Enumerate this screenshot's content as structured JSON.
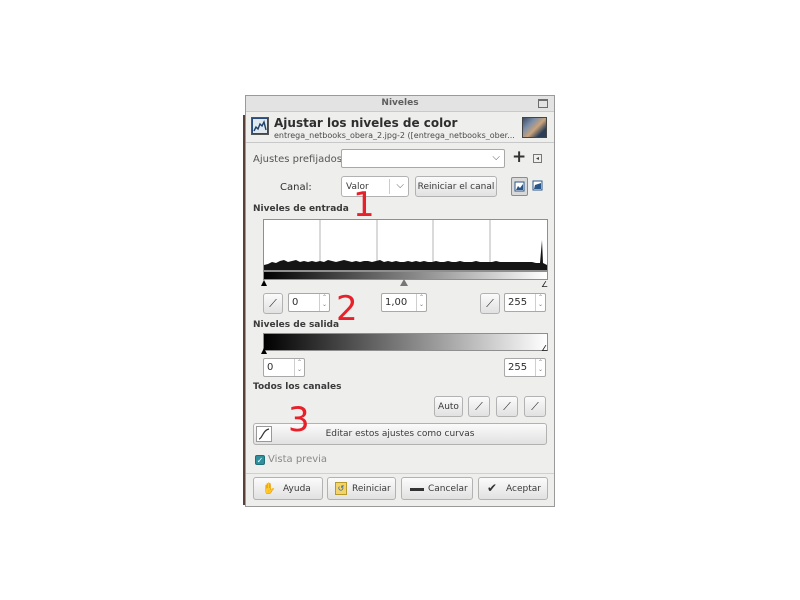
{
  "window": {
    "title": "Niveles"
  },
  "header": {
    "title": "Ajustar los niveles de color",
    "subtitle": "entrega_netbooks_obera_2.jpg-2 ([entrega_netbooks_ober..."
  },
  "presets": {
    "label": "Ajustes prefijados:",
    "value": ""
  },
  "channel": {
    "label": "Canal:",
    "value": "Valor",
    "reset_label": "Reiniciar el canal"
  },
  "input_levels": {
    "title": "Niveles de entrada",
    "low": "0",
    "gamma": "1,00",
    "high": "255"
  },
  "output_levels": {
    "title": "Niveles de salida",
    "low": "0",
    "high": "255"
  },
  "all_channels": {
    "title": "Todos los canales",
    "auto_label": "Auto"
  },
  "curves_button": {
    "label": "Editar estos ajustes como curvas"
  },
  "preview": {
    "label": "Vista previa",
    "checked": true
  },
  "buttons": {
    "help": "Ayuda",
    "reset": "Reiniciar",
    "cancel": "Cancelar",
    "ok": "Aceptar"
  },
  "annotations": [
    "1",
    "2",
    "3"
  ],
  "icons": [
    "levels-icon",
    "image-thumbnail-icon",
    "add-icon",
    "menu-arrow-icon",
    "linear-histogram-icon",
    "log-histogram-icon",
    "pipette-icon",
    "curves-icon",
    "help-icon",
    "reset-icon",
    "cancel-icon",
    "ok-icon"
  ],
  "colors": {
    "annotation": "#e8202a",
    "dialog_bg": "#eeeeec",
    "check": "#2f8f9d"
  }
}
